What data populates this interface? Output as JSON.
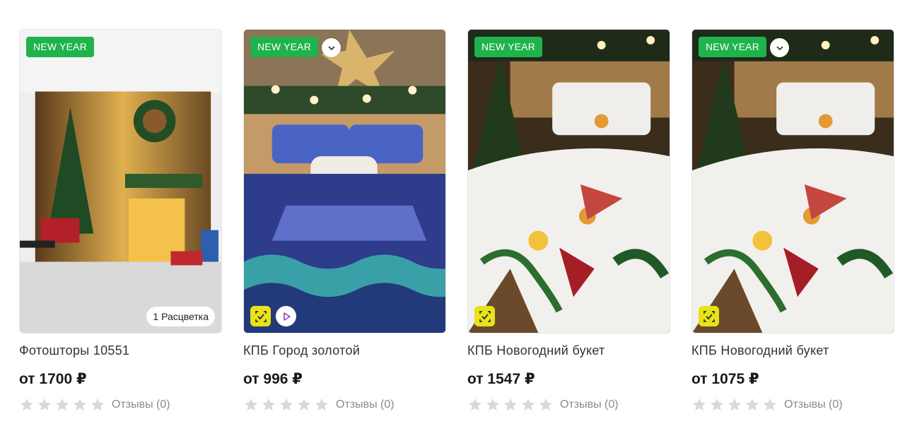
{
  "products": [
    {
      "badge": "NEW YEAR",
      "colors_label": "1 Расцветка",
      "has_dropdown": false,
      "has_mark_icon": false,
      "has_video_icon": false,
      "title": "Фотошторы 10551",
      "price": "от 1700 ₽",
      "rating": 0,
      "reviews": "Отзывы (0)"
    },
    {
      "badge": "NEW YEAR",
      "has_dropdown": true,
      "has_mark_icon": true,
      "has_video_icon": true,
      "title": "КПБ Город золотой",
      "price": "от 996 ₽",
      "rating": 0,
      "reviews": "Отзывы (0)"
    },
    {
      "badge": "NEW YEAR",
      "has_dropdown": false,
      "has_mark_icon": true,
      "has_video_icon": false,
      "title": "КПБ Новогодний букет",
      "price": "от 1547 ₽",
      "rating": 0,
      "reviews": "Отзывы (0)"
    },
    {
      "badge": "NEW YEAR",
      "has_dropdown": true,
      "has_mark_icon": true,
      "has_video_icon": false,
      "title": "КПБ Новогодний букет",
      "price": "от 1075 ₽",
      "rating": 0,
      "reviews": "Отзывы (0)"
    }
  ],
  "colors": {
    "badge_green": "#1fb34b",
    "mark_yellow": "#e8e316",
    "star_empty": "#d9d9d9",
    "video_purple": "#8e44c9"
  }
}
